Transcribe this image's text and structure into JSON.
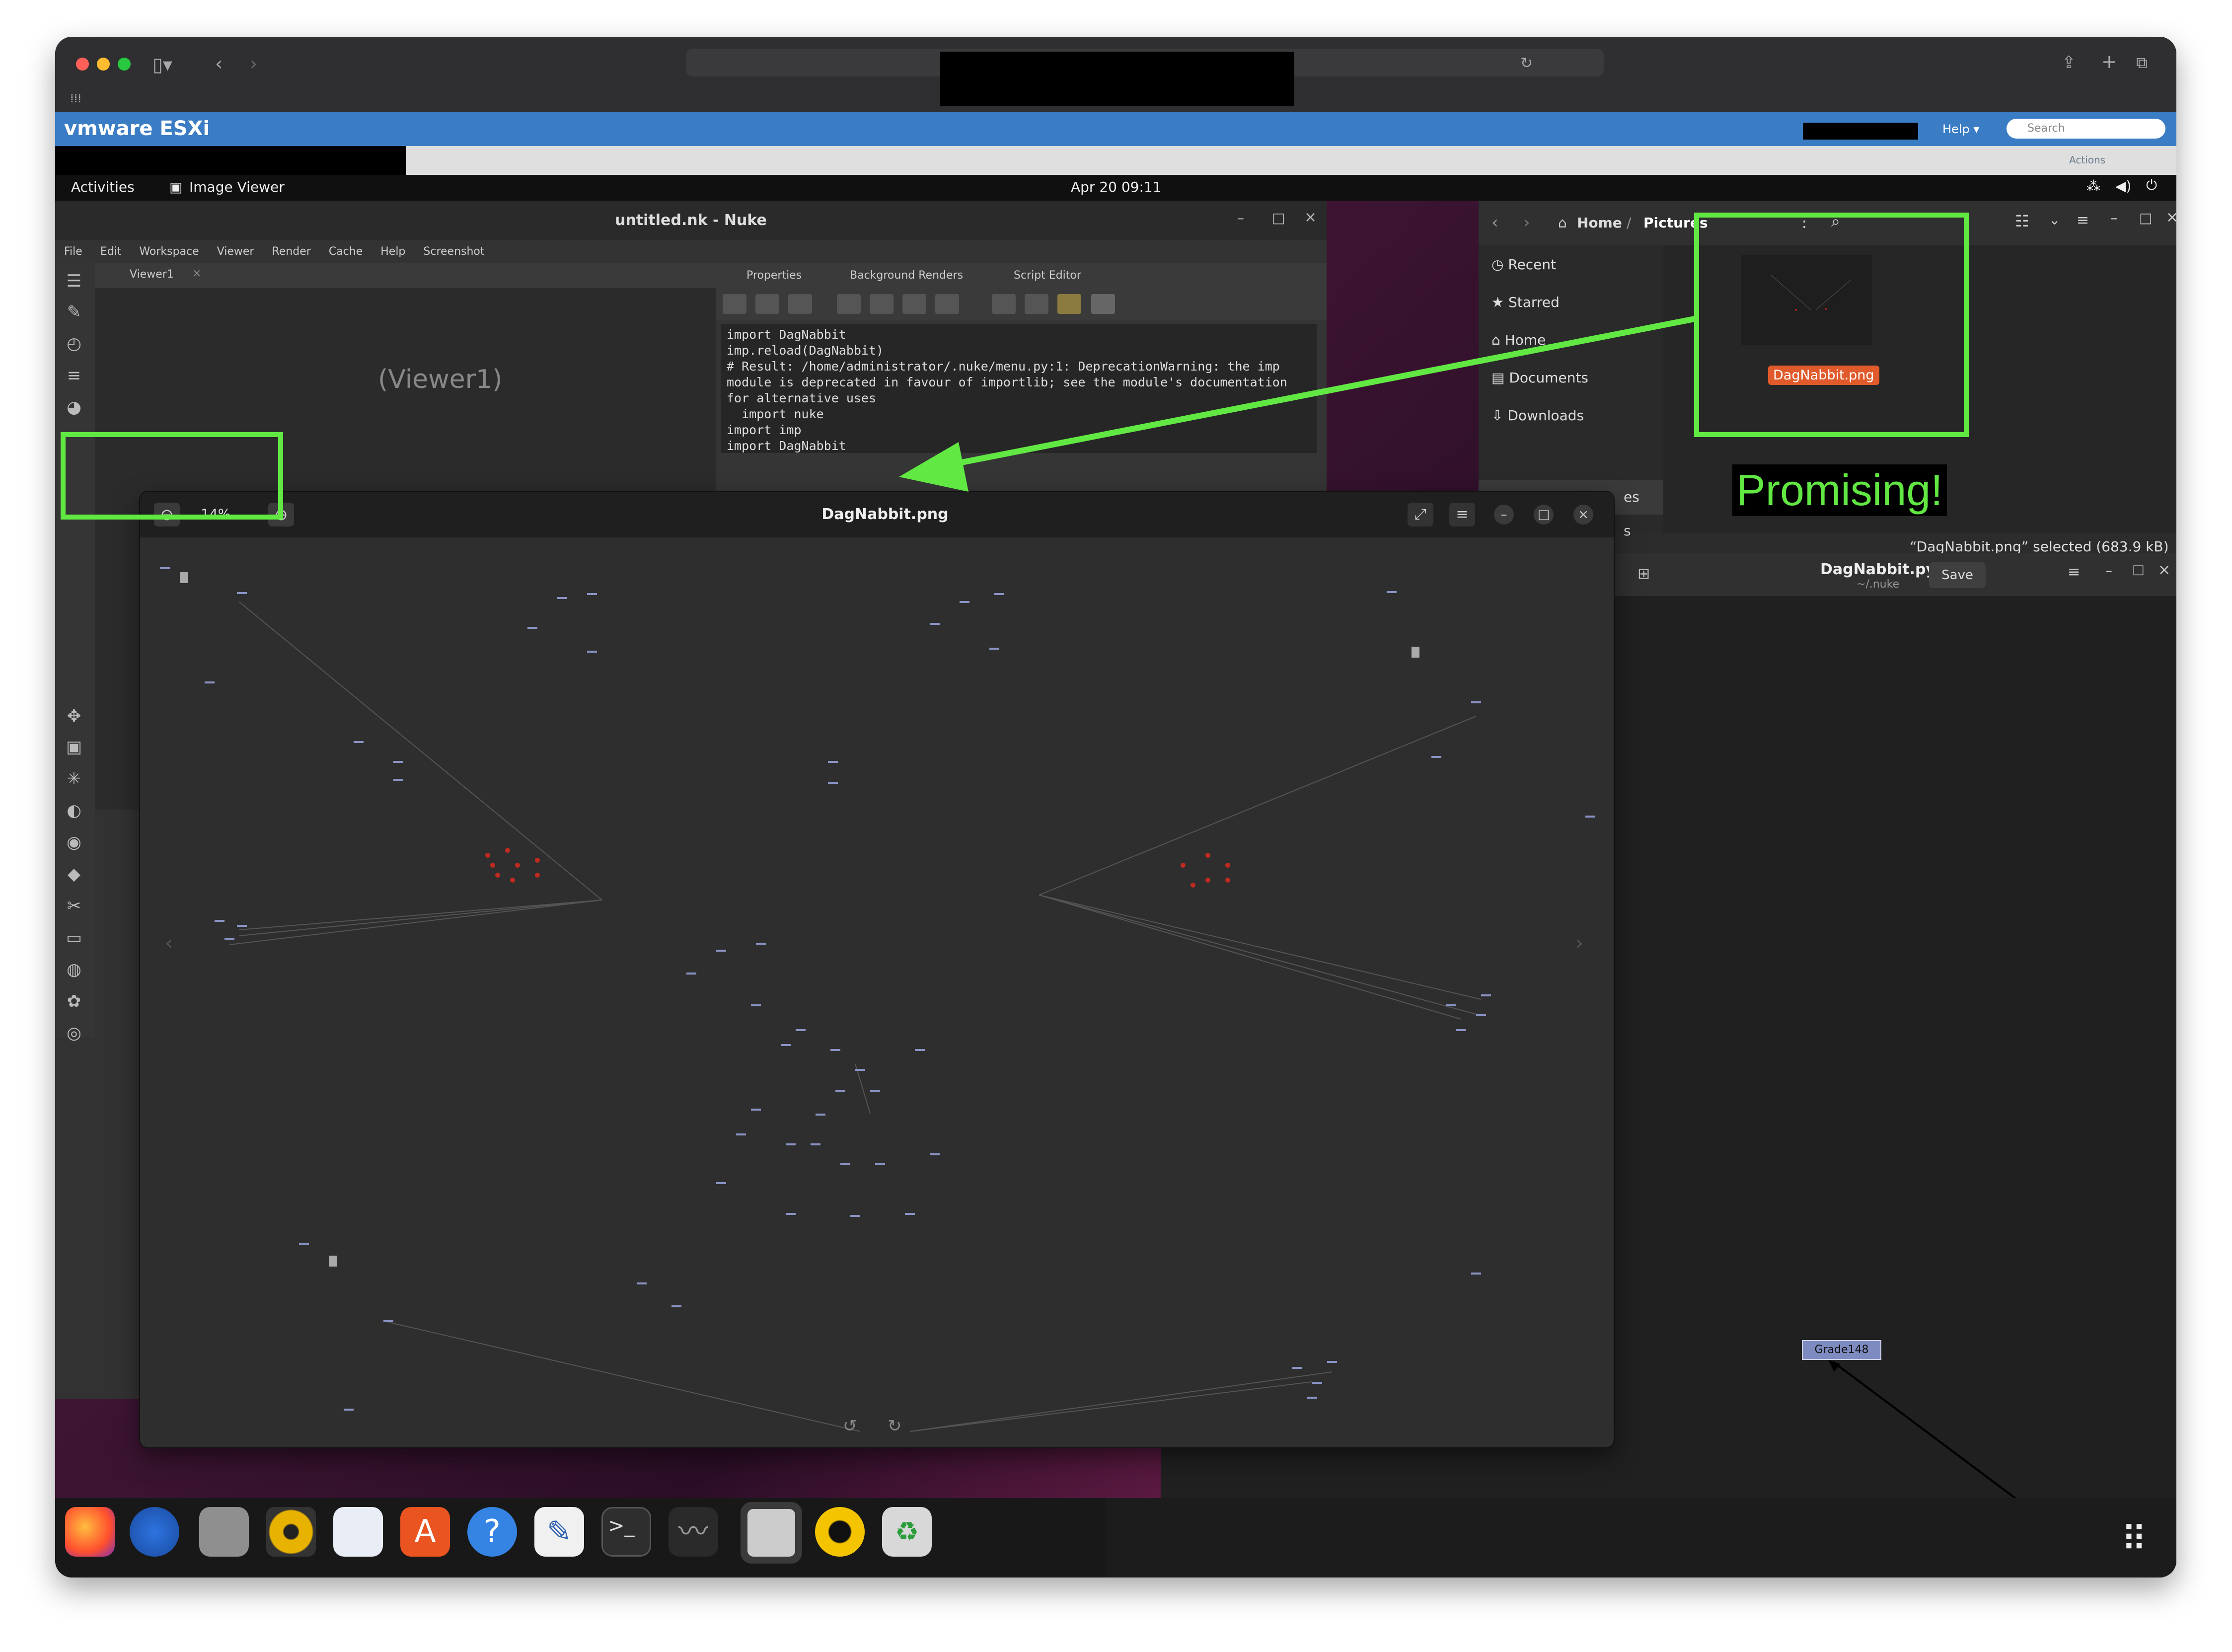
{
  "esxi": {
    "brand": "vmware ESXi",
    "help": "Help ▾",
    "search_placeholder": "Search",
    "actions": "Actions"
  },
  "gnome": {
    "activities": "Activities",
    "app_name": "Image Viewer",
    "clock": "Apr 20  09:11"
  },
  "nuke": {
    "title": "untitled.nk - Nuke",
    "menu": [
      "File",
      "Edit",
      "Workspace",
      "Viewer",
      "Render",
      "Cache",
      "Help",
      "Screenshot"
    ],
    "viewer_tab": "Viewer1",
    "viewer_label": "(Viewer1)",
    "tabs": [
      "Properties",
      "Background Renders",
      "Script Editor"
    ],
    "script_lines": [
      "import DagNabbit",
      "imp.reload(DagNabbit)",
      "# Result: /home/administrator/.nuke/menu.py:1: DeprecationWarning: the imp",
      "module is deprecated in favour of importlib; see the module's documentation",
      "for alternative uses",
      "  import nuke",
      "import imp",
      "import DagNabbit"
    ]
  },
  "files": {
    "breadcrumb_home": "Home",
    "breadcrumb_folder": "Pictures",
    "sidebar": [
      "Recent",
      "Starred",
      "Home",
      "Documents",
      "Downloads"
    ],
    "partial_sidebar": "es",
    "partial_sidebar2": "s",
    "file_name": "DagNabbit.png",
    "status": "“DagNabbit.png” selected (683.9 kB)"
  },
  "gedit": {
    "title": "DagNabbit.py",
    "subtitle": "~/.nuke",
    "save": "Save",
    "node_label": "Grade148"
  },
  "image_viewer": {
    "title": "DagNabbit.png",
    "zoom": "14%"
  },
  "annotation": {
    "text": "Promising!",
    "color": "#61e843"
  },
  "dock_apps": [
    "firefox-icon",
    "thunderbird-icon",
    "files-icon",
    "rhythmbox-icon",
    "writer-icon",
    "app-center-icon",
    "help-icon",
    "text-editor-icon",
    "terminal-icon",
    "system-monitor-icon",
    "image-viewer-icon",
    "nuke-icon",
    "trash-icon"
  ]
}
